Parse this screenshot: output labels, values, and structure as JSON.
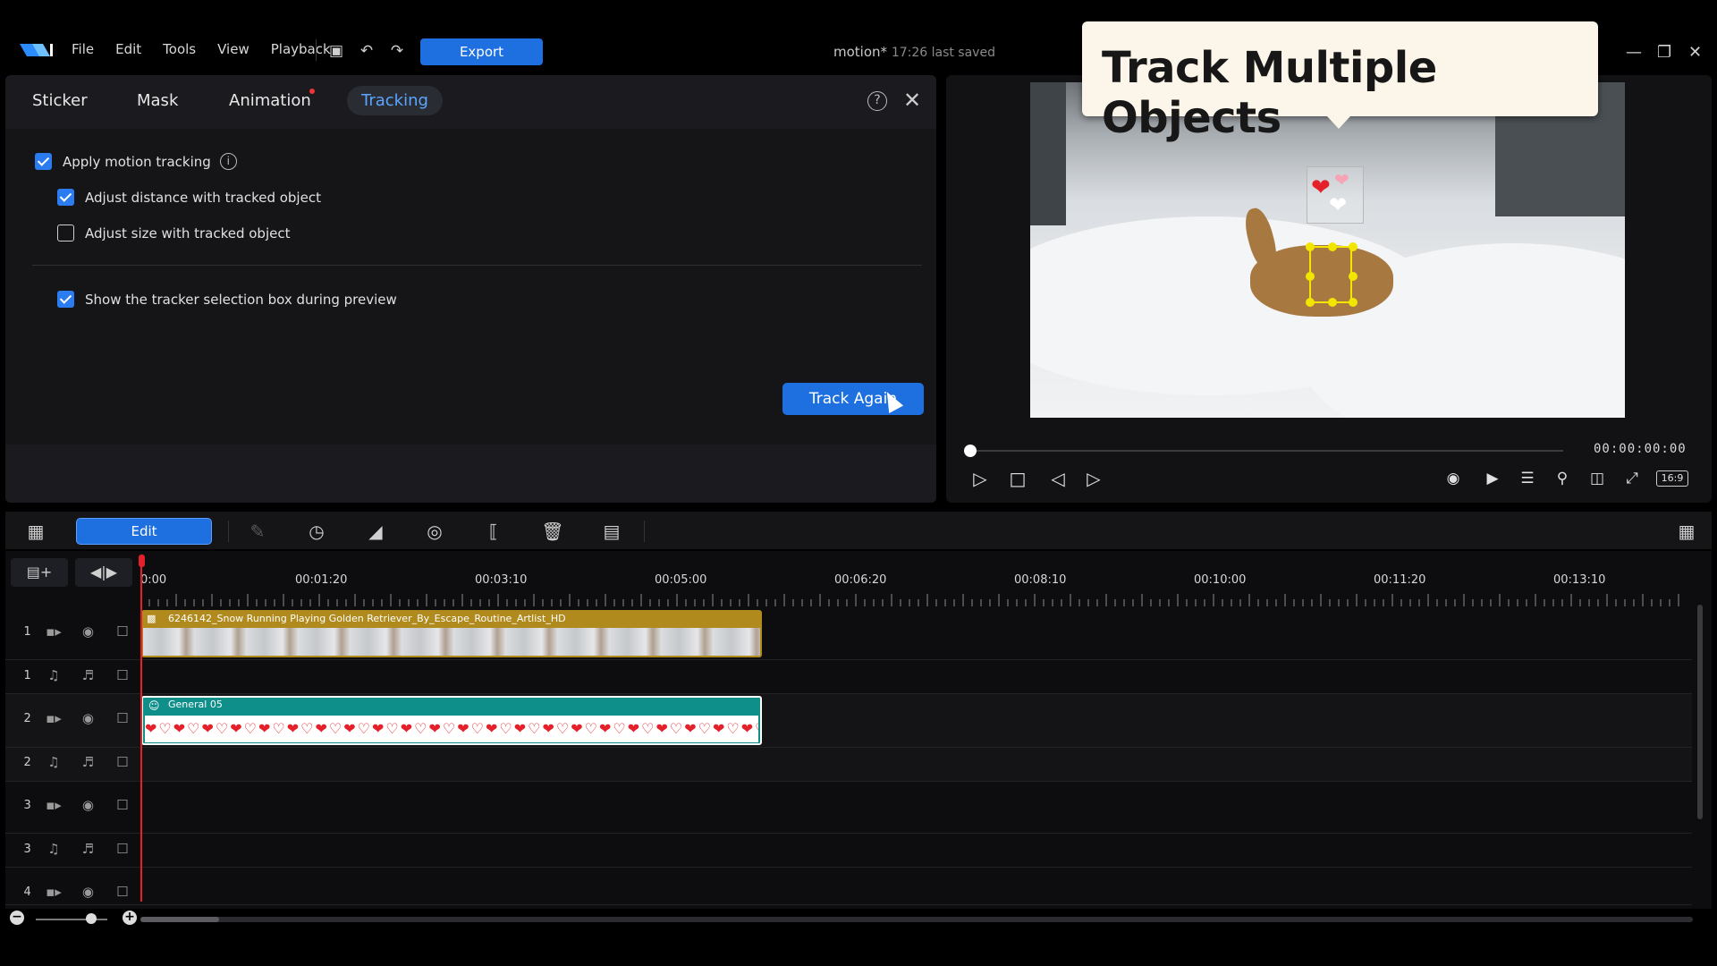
{
  "menu": [
    "File",
    "Edit",
    "Tools",
    "View",
    "Playback"
  ],
  "toolbar": {
    "export_label": "Export"
  },
  "document": {
    "name": "motion*",
    "saved_text": "17:26 last saved"
  },
  "tracking_panel": {
    "tabs": [
      {
        "label": "Sticker"
      },
      {
        "label": "Mask"
      },
      {
        "label": "Animation"
      },
      {
        "label": "Tracking"
      }
    ],
    "active_tab": "Tracking",
    "options": {
      "apply_motion_tracking": {
        "label": "Apply motion tracking",
        "checked": true
      },
      "adjust_distance": {
        "label": "Adjust distance with tracked object",
        "checked": true
      },
      "adjust_size": {
        "label": "Adjust size with tracked object",
        "checked": false
      },
      "show_tracker_box": {
        "label": "Show the tracker selection box during preview",
        "checked": true
      }
    },
    "track_again_label": "Track Again"
  },
  "preview": {
    "callout_text": "Track Multiple Objects",
    "timecode": "00:00:00:00",
    "playback_progress": 0,
    "aspect_ratio_label": "16:9"
  },
  "timeline_toolbar": {
    "edit_label": "Edit"
  },
  "timeline": {
    "ruler_labels": [
      "0:00",
      "00:01:20",
      "00:03:10",
      "00:05:00",
      "00:06:20",
      "00:08:10",
      "00:10:00",
      "00:11:20",
      "00:13:10"
    ],
    "tracks": [
      {
        "number": "1",
        "kind": "video"
      },
      {
        "number": "1",
        "kind": "audio"
      },
      {
        "number": "2",
        "kind": "video"
      },
      {
        "number": "2",
        "kind": "audio"
      },
      {
        "number": "3",
        "kind": "video"
      },
      {
        "number": "3",
        "kind": "audio"
      },
      {
        "number": "4",
        "kind": "video"
      }
    ],
    "clips": {
      "video_clip_title": "6246142_Snow Running Playing Golden Retriever_By_Escape_Routine_Artlist_HD",
      "sticker_clip_title": "General 05"
    }
  },
  "colors": {
    "accent": "#1e6fe0",
    "tab_active_text": "#5aa6ff",
    "video_clip": "#b08a1c",
    "sticker_clip": "#0f8f8a",
    "playhead": "#e4202a",
    "tracker_box": "#f2e600"
  }
}
